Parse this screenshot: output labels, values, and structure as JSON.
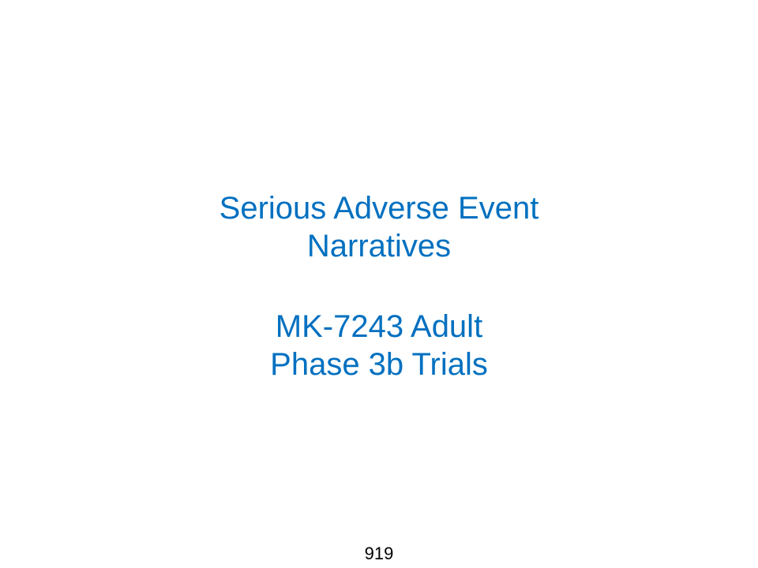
{
  "slide": {
    "title_lines": [
      "Serious Adverse Event",
      "Narratives"
    ],
    "subtitle_lines": [
      "MK-7243 Adult",
      "Phase 3b Trials"
    ],
    "page_number": "919"
  },
  "colors": {
    "title_text": "#0070c0",
    "page_number_text": "#000000",
    "background": "#ffffff"
  }
}
